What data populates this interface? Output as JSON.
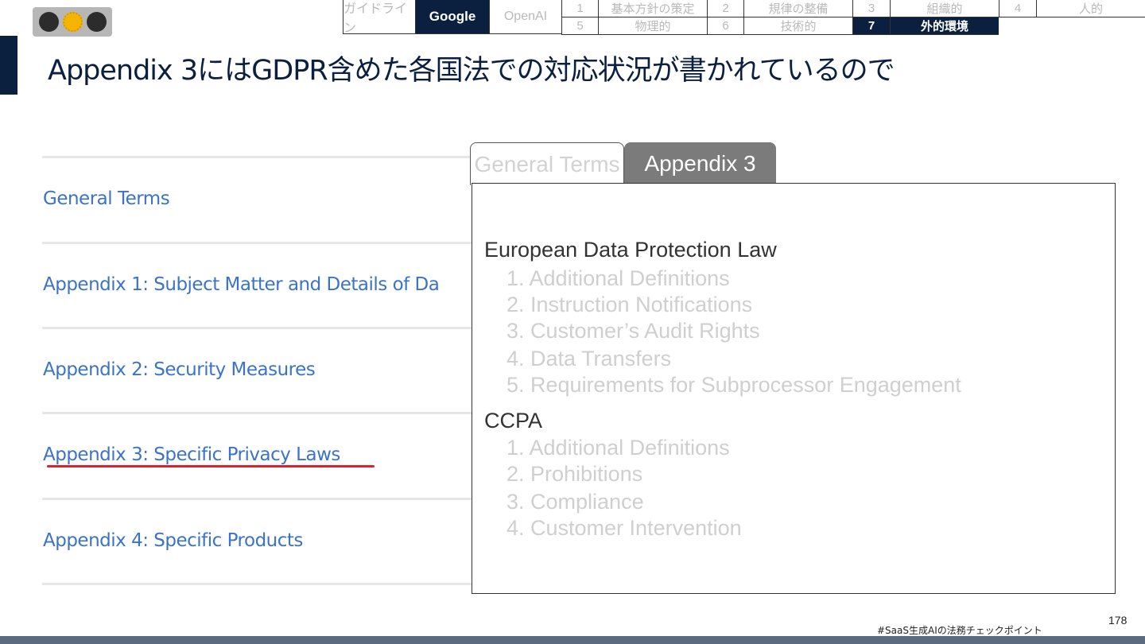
{
  "nav": {
    "vendors": [
      "ガイドライン",
      "Google",
      "OpenAI"
    ],
    "active_vendor": "Google",
    "sections_row1": [
      {
        "num": "1",
        "label": "基本方針の策定"
      },
      {
        "num": "2",
        "label": "規律の整備"
      },
      {
        "num": "3",
        "label": "組織的"
      },
      {
        "num": "4",
        "label": "人的"
      }
    ],
    "sections_row2": [
      {
        "num": "5",
        "label": "物理的"
      },
      {
        "num": "6",
        "label": "技術的"
      },
      {
        "num": "7",
        "label": "外的環境"
      }
    ],
    "active_section": "7"
  },
  "title": "Appendix 3にはGDPR含めた各国法での対応状況が書かれているので",
  "doc_list": [
    "General Terms",
    "Appendix 1: Subject Matter and Details of Da",
    "Appendix 2: Security Measures",
    "Appendix 3: Specific Privacy Laws",
    "Appendix 4: Specific Products"
  ],
  "tabs": {
    "inactive": "General Terms",
    "active": "Appendix 3"
  },
  "panel": {
    "sections": [
      {
        "heading": "European Data Protection Law",
        "items": [
          "1. Additional Definitions",
          "2. Instruction Notifications",
          "3. Customer’s Audit Rights",
          "4. Data Transfers",
          "5. Requirements for Subprocessor Engagement"
        ]
      },
      {
        "heading": "CCPA",
        "items": [
          "1. Additional Definitions",
          "2. Prohibitions",
          "3. Compliance",
          "4. Customer Intervention"
        ]
      }
    ]
  },
  "footer": {
    "hashtag": "#SaaS生成AIの法務チェックポイント",
    "page": "178"
  },
  "colors": {
    "navy": "#0b1f3f",
    "link_blue": "#3b73c8",
    "underline_red": "#e0202a",
    "active_tab": "#7b7b7b"
  }
}
